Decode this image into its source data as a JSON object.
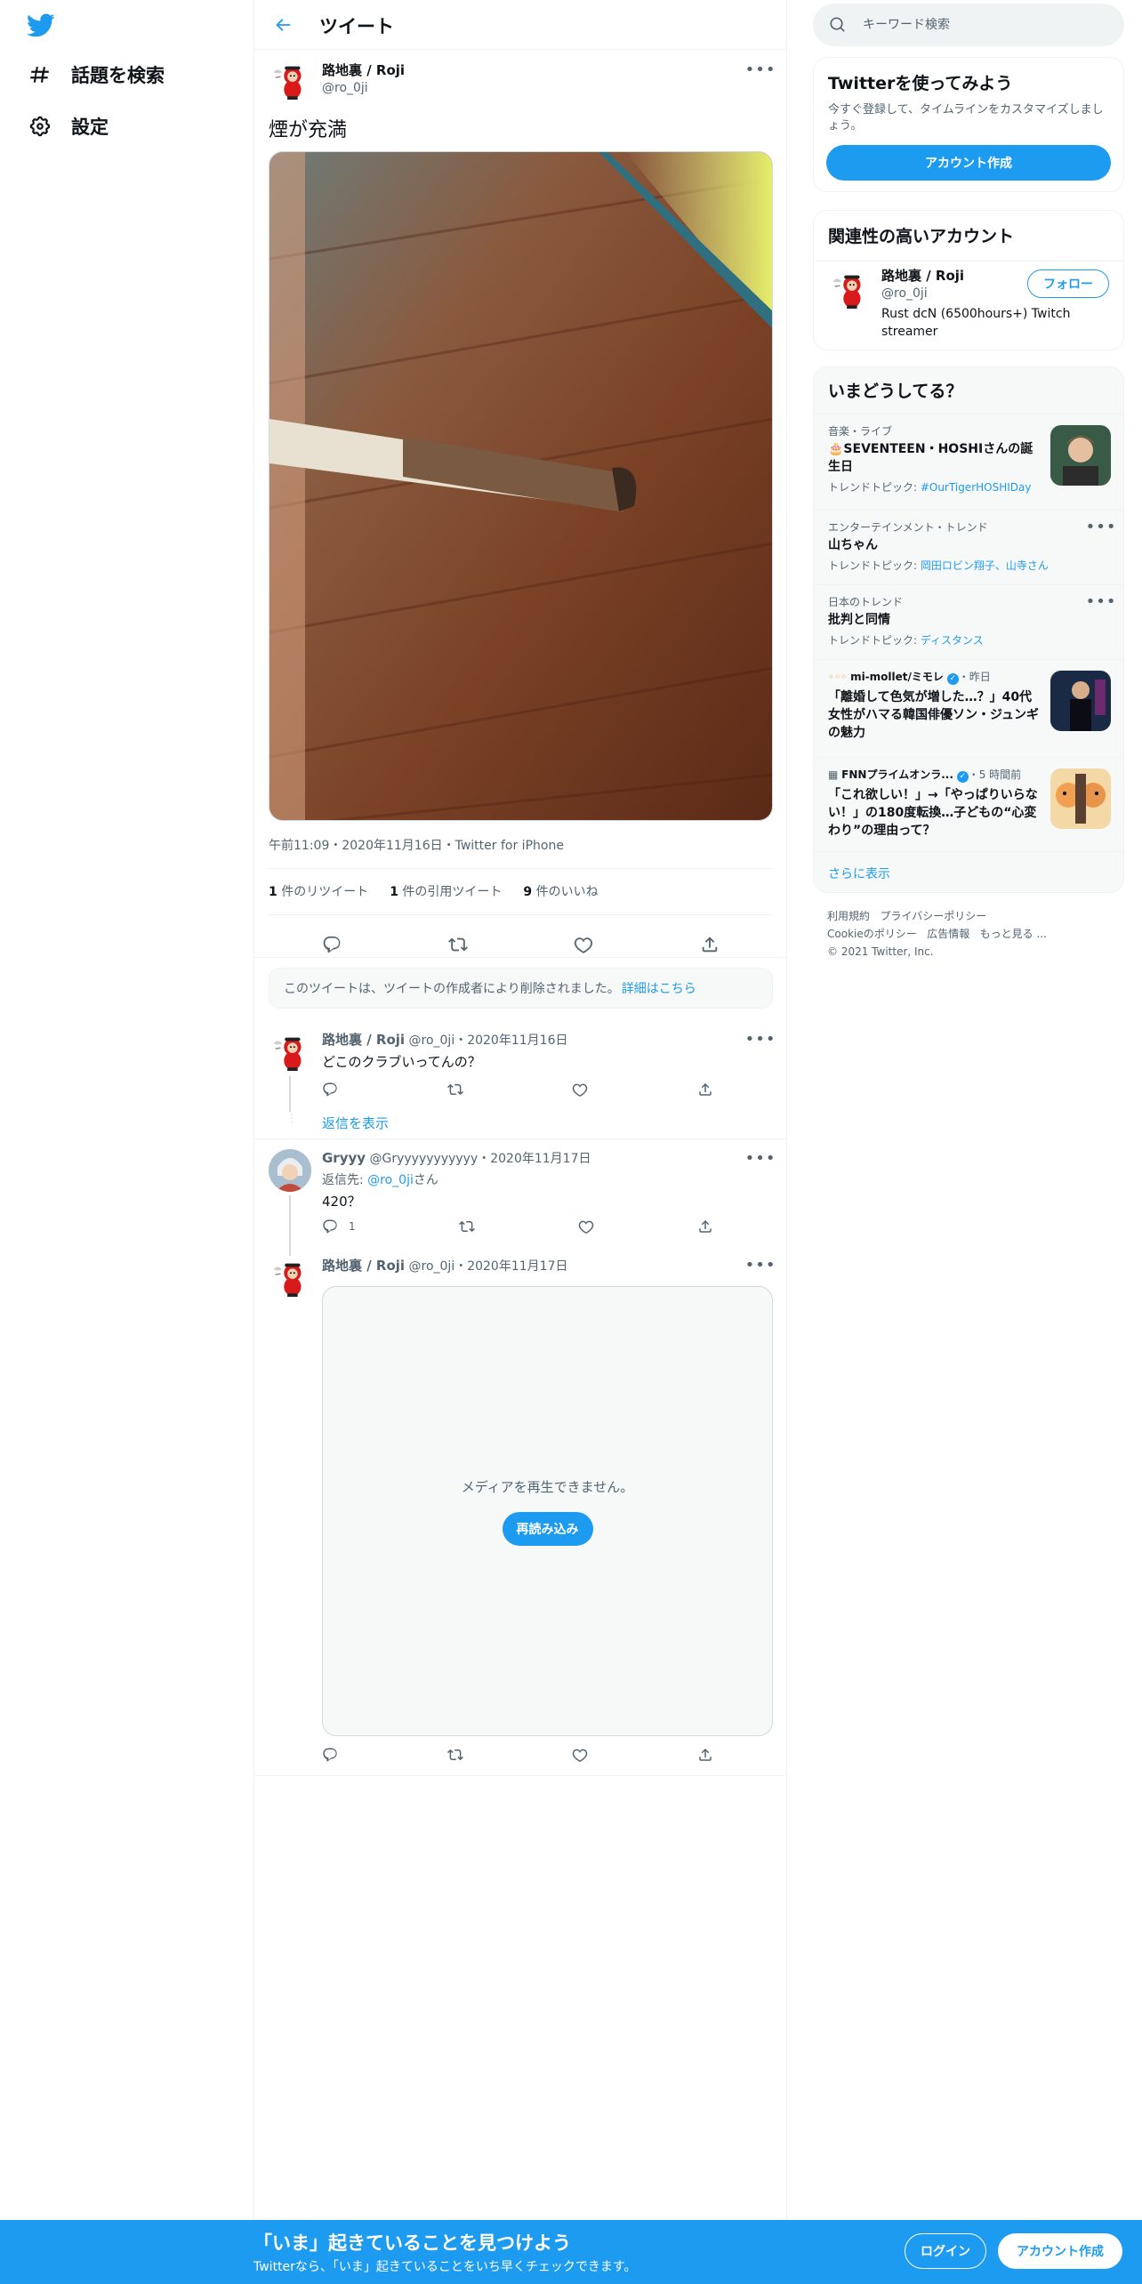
{
  "nav": {
    "explore_label": "話題を検索",
    "settings_label": "設定"
  },
  "header": {
    "title": "ツイート"
  },
  "main_tweet": {
    "name": "路地裏 / Roji",
    "handle": "@ro_0ji",
    "text": "煙が充満",
    "meta": "午前11:09・2020年11月16日・Twitter for iPhone",
    "stats": {
      "retweets_count": "1",
      "retweets_label": "件のリツイート",
      "quotes_count": "1",
      "quotes_label": "件の引用ツイート",
      "likes_count": "9",
      "likes_label": "件のいいね"
    }
  },
  "deleted_notice": {
    "text": "このツイートは、ツイートの作成者により削除されました。",
    "link": "詳細はこちら"
  },
  "replies": [
    {
      "name": "路地裏 / Roji",
      "handle_date": "@ro_0ji・2020年11月16日",
      "text": "どこのクラブいってんの？",
      "show_replies": "返信を表示"
    },
    {
      "name": "Gryyy",
      "handle_date": "@Gryyyyyyyyyyy・2020年11月17日",
      "reply_to_prefix": "返信先: ",
      "reply_to_handle": "@ro_0ji",
      "reply_to_suffix": "さん",
      "text": "420？",
      "reply_count": "1"
    },
    {
      "name": "路地裏 / Roji",
      "handle_date": "@ro_0ji・2020年11月17日",
      "media_error": "メディアを再生できません。",
      "reload_label": "再読み込み"
    }
  ],
  "search": {
    "placeholder": "キーワード検索"
  },
  "signup_card": {
    "title": "Twitterを使ってみよう",
    "desc": "今すぐ登録して、タイムラインをカスタマイズしましょう。",
    "button": "アカウント作成"
  },
  "relevant": {
    "title": "関連性の高いアカウント",
    "name": "路地裏 / Roji",
    "handle": "@ro_0ji",
    "bio": "Rust dcN (6500hours+) Twitch streamer",
    "follow_label": "フォロー"
  },
  "trends": {
    "title": "いまどうしてる？",
    "items": [
      {
        "meta": "音楽・ライブ",
        "title": "🎂SEVENTEEN・HOSHIさんの誕生日",
        "topic_prefix": "トレンドトピック: ",
        "topic": "#OurTigerHOSHIDay"
      },
      {
        "meta": "エンターテインメント・トレンド",
        "title": "山ちゃん",
        "topic_prefix": "トレンドトピック: ",
        "topic": "岡田ロビン翔子、山寺さん"
      },
      {
        "meta": "日本のトレンド",
        "title": "批判と同情",
        "topic_prefix": "トレンドトピック: ",
        "topic": "ディスタンス"
      },
      {
        "source": "mi-mollet/ミモレ",
        "time": "・昨日",
        "title": "「離婚して色気が増した…？」40代女性がハマる韓国俳優ソン・ジュンギの魅力"
      },
      {
        "source": "FNNプライムオンラ...",
        "time": "・5 時間前",
        "title": "「これ欲しい！」→「やっぱりいらない！」の180度転換…子どもの“心変わり”の理由って？"
      }
    ],
    "show_more": "さらに表示"
  },
  "footer": {
    "terms": "利用規約",
    "privacy": "プライバシーポリシー",
    "cookie": "Cookieのポリシー",
    "ads": "広告情報",
    "more": "もっと見る ...",
    "copyright": "© 2021 Twitter, Inc."
  },
  "bottom_bar": {
    "title": "「いま」起きていることを見つけよう",
    "subtitle": "Twitterなら、「いま」起きていることをいち早くチェックできます。",
    "login": "ログイン",
    "signup": "アカウント作成"
  },
  "colors": {
    "accent": "#1d9bf0",
    "text": "#0f1419",
    "secondary": "#536471",
    "border": "#eff3f4"
  }
}
